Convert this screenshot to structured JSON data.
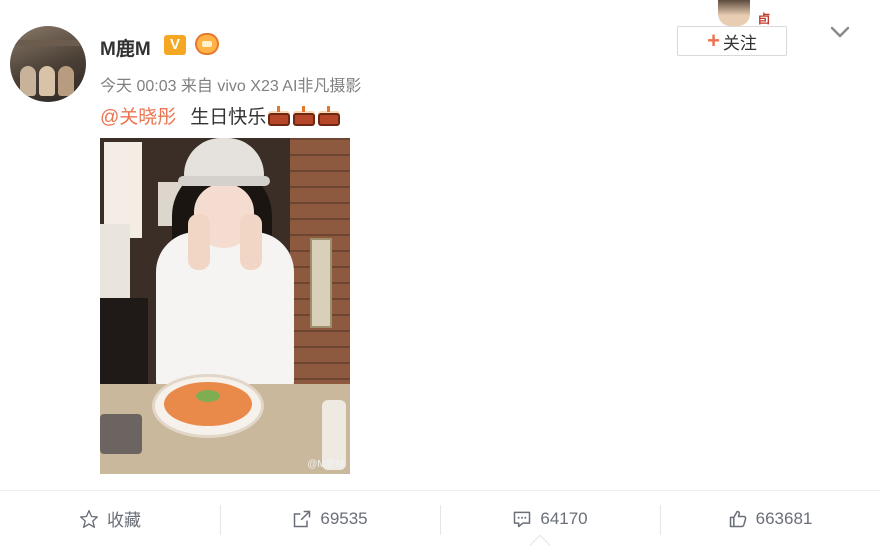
{
  "post": {
    "username": "M鹿M",
    "verified_badge": "V",
    "meta": "今天 00:03 来自 vivo X23 AI非凡摄影",
    "mention": "@关晓彤",
    "text": "生日快乐",
    "emoji": "cake-icon",
    "emoji_count": 3,
    "photo_watermark": "@M鹿M"
  },
  "follow": {
    "label": "关注",
    "mark": "卣"
  },
  "actions": {
    "favorite_label": "收藏",
    "repost_count": "69535",
    "comment_count": "64170",
    "like_count": "663681"
  },
  "colors": {
    "accent": "#eb7350",
    "verified": "#f5a623",
    "muted_text": "#808080",
    "action_text": "#696e78"
  }
}
